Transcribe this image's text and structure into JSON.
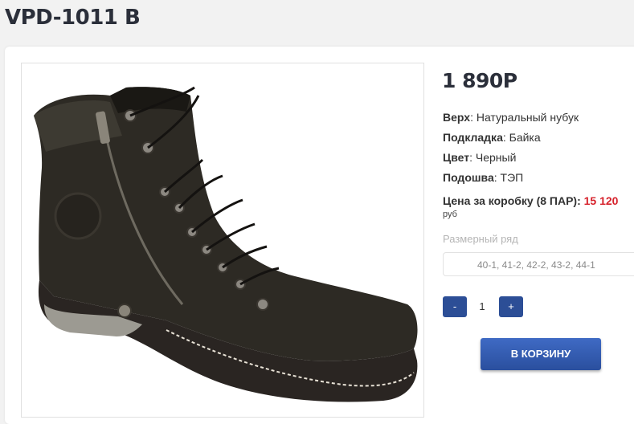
{
  "product": {
    "title": "VPD-1011 B",
    "price": "1 890Р",
    "specs": [
      {
        "label": "Верх",
        "value": ": Натуральный нубук"
      },
      {
        "label": "Подкладка",
        "value": ": Байка"
      },
      {
        "label": "Цвет",
        "value": ": Черный"
      },
      {
        "label": "Подошва",
        "value": ": ТЭП"
      }
    ],
    "box_price": {
      "label": "Цена за коробку (8 ПАР):",
      "value": "15 120",
      "unit": "руб"
    },
    "image": {
      "icon": "boot-product-image"
    }
  },
  "size": {
    "label": "Размерный ряд",
    "value": "40-1, 41-2, 42-2, 43-2, 44-1"
  },
  "quantity": {
    "minus": "-",
    "value": "1",
    "plus": "+"
  },
  "cart_button": "В КОРЗИНУ",
  "colors": {
    "accent": "#2c4e96",
    "price_red": "#d6202a"
  }
}
